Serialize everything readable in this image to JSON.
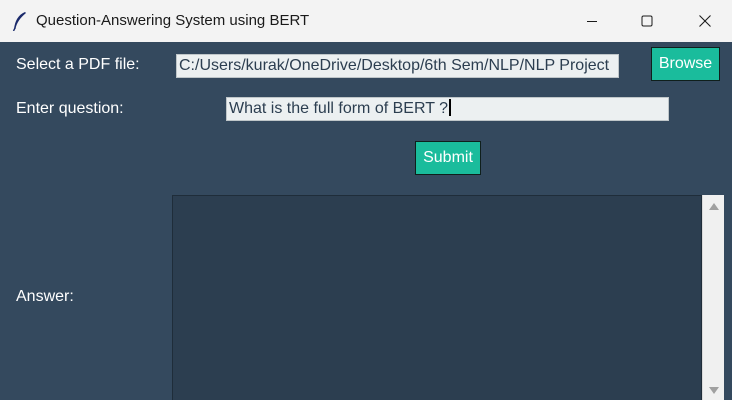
{
  "window": {
    "title": "Question-Answering System using BERT",
    "icon": "feather-icon",
    "controls": [
      "minimize-icon",
      "maximize-icon",
      "close-icon"
    ]
  },
  "form": {
    "pdf_label": "Select a PDF file:",
    "pdf_path": "C:/Users/kurak/OneDrive/Desktop/6th Sem/NLP/NLP Project",
    "browse_label": "Browse",
    "question_label": "Enter question:",
    "question_value": "What is the full form of BERT ?",
    "submit_label": "Submit",
    "answer_label": "Answer:",
    "answer_value": ""
  },
  "colors": {
    "background": "#34495e",
    "accent": "#1abc9c",
    "answer_bg": "#2c3e50",
    "entry_bg": "#ecf0f1"
  }
}
